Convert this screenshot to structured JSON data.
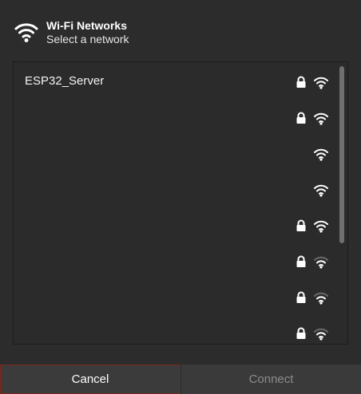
{
  "header": {
    "title": "Wi-Fi Networks",
    "subtitle": "Select a network",
    "icon": "wifi-icon"
  },
  "networks": [
    {
      "name": "ESP32_Server",
      "secured": true,
      "signal": "full"
    },
    {
      "name": "",
      "secured": true,
      "signal": "full"
    },
    {
      "name": "",
      "secured": false,
      "signal": "full"
    },
    {
      "name": "",
      "secured": false,
      "signal": "full"
    },
    {
      "name": "",
      "secured": true,
      "signal": "full"
    },
    {
      "name": "",
      "secured": true,
      "signal": "medium"
    },
    {
      "name": "",
      "secured": true,
      "signal": "medium"
    },
    {
      "name": "",
      "secured": true,
      "signal": "medium"
    }
  ],
  "footer": {
    "cancel_label": "Cancel",
    "connect_label": "Connect"
  },
  "colors": {
    "background": "#2c2c2c",
    "cancel_border": "#7a2a1c",
    "disabled_text": "#8c8c8c"
  }
}
